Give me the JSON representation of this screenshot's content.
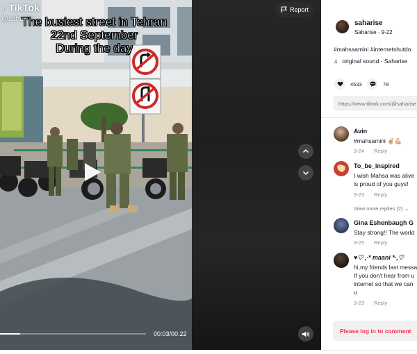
{
  "video": {
    "logo": "TikTok",
    "handle": "@saharise",
    "overlay_lines": [
      "The busiest street in Tehran",
      "22nd September",
      "During the day"
    ],
    "report_label": "Report",
    "time": "00:03/00:22",
    "progress_fraction": 0.136
  },
  "author": {
    "username": "saharise",
    "meta": "Saharise · 9-22"
  },
  "caption": "#mahsaamini #internetshutdo",
  "sound": {
    "icon": "♫",
    "label": "original sound - Saharise"
  },
  "stats": {
    "likes": "4533",
    "comments": "78"
  },
  "share_link": "https://www.tiktok.com/@saharise",
  "comments": [
    {
      "name": "Avin",
      "lines": [
        "#mahsamini ✌🏼💪🏼"
      ],
      "date": "9-24",
      "reply": "Reply"
    },
    {
      "name": "To_be_inspired",
      "lines": [
        "I wish Mahsa was alive",
        "is proud of you guys!"
      ],
      "date": "9-23",
      "reply": "Reply"
    },
    {
      "name": "Gina Eshenbaugh G",
      "lines": [
        "Stay strong!! The world"
      ],
      "date": "9-25",
      "reply": "Reply"
    },
    {
      "name": "♥♡ ‚∙* maani *∙‚♡",
      "lines": [
        "hi,my friends last messa",
        "If you don't hear from u",
        "internet so that we can",
        "u"
      ],
      "date": "9-23",
      "reply": "Reply"
    }
  ],
  "view_more_replies": "View more replies (2)",
  "login_prompt": "Please log in to comment",
  "colors": {
    "accent": "#fe2c55",
    "text": "#161823",
    "muted": "#8a8b91"
  },
  "icons": [
    "tiktok-logo-icon",
    "flag-icon",
    "play-icon",
    "chevron-up-icon",
    "chevron-down-icon",
    "volume-icon",
    "heart-icon",
    "comment-icon",
    "music-note-icon"
  ]
}
